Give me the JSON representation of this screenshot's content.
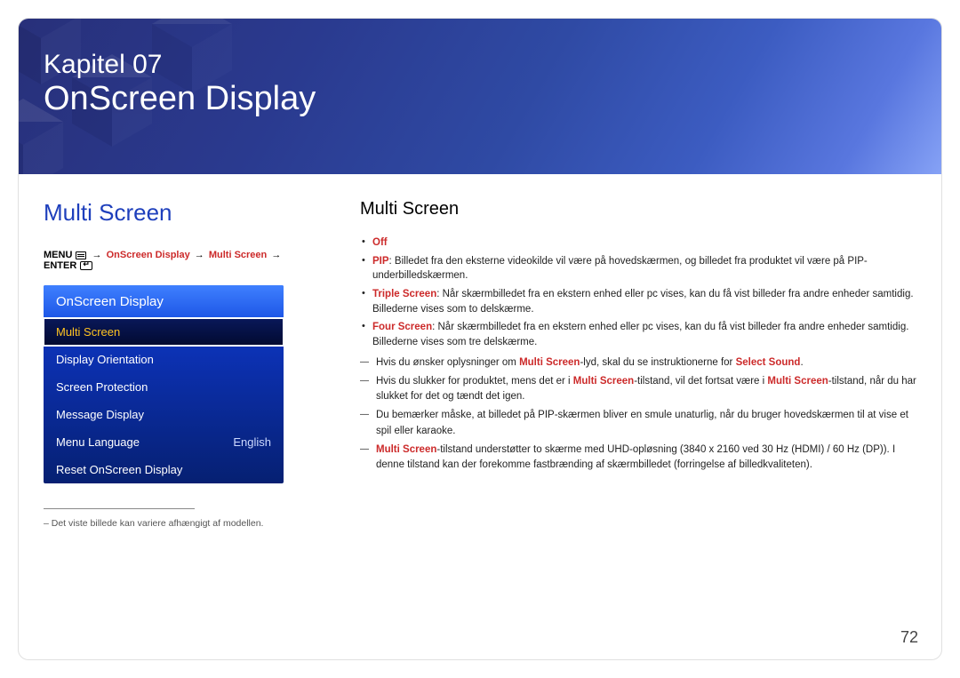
{
  "banner": {
    "chapter": "Kapitel 07",
    "name": "OnScreen Display"
  },
  "left": {
    "section_title": "Multi Screen",
    "breadcrumb": {
      "menu": "MENU",
      "p1": "OnScreen Display",
      "p2": "Multi Screen",
      "enter": "ENTER"
    },
    "osd": {
      "header": "OnScreen Display",
      "items": [
        {
          "label": "Multi Screen",
          "value": "",
          "selected": true
        },
        {
          "label": "Display Orientation",
          "value": "",
          "selected": false
        },
        {
          "label": "Screen Protection",
          "value": "",
          "selected": false
        },
        {
          "label": "Message Display",
          "value": "",
          "selected": false
        },
        {
          "label": "Menu Language",
          "value": "English",
          "selected": false
        },
        {
          "label": "Reset OnScreen Display",
          "value": "",
          "selected": false
        }
      ]
    },
    "footnote": "– Det viste billede kan variere afhængigt af modellen."
  },
  "right": {
    "title": "Multi Screen",
    "bullets": {
      "b0": "Off",
      "b1_lead": "PIP",
      "b1_rest": ": Billedet fra den eksterne videokilde vil være på hovedskærmen, og billedet fra produktet vil være på PIP-underbilledskærmen.",
      "b2_lead": "Triple Screen",
      "b2_rest": ": Når skærmbilledet fra en ekstern enhed eller pc vises, kan du få vist billeder fra andre enheder samtidig. Billederne vises som to delskærme.",
      "b3_lead": "Four Screen",
      "b3_rest": ": Når skærmbilledet fra en ekstern enhed eller pc vises, kan du få vist billeder fra andre enheder samtidig. Billederne vises som tre delskærme."
    },
    "dashes": {
      "d0_a": "Hvis du ønsker oplysninger om ",
      "d0_b": "Multi Screen",
      "d0_c": "-lyd, skal du se instruktionerne for ",
      "d0_d": "Select Sound",
      "d0_e": ".",
      "d1_a": "Hvis du slukker for produktet, mens det er i ",
      "d1_b": "Multi Screen",
      "d1_c": "-tilstand, vil det fortsat være i ",
      "d1_d": "Multi Screen",
      "d1_e": "-tilstand, når du har slukket for det og tændt det igen.",
      "d2": "Du bemærker måske, at billedet på PIP-skærmen bliver en smule unaturlig, når du bruger hovedskærmen til at vise et spil eller karaoke.",
      "d3_a": "Multi Screen",
      "d3_b": "-tilstand understøtter to skærme med UHD-opløsning (3840 x 2160 ved 30 Hz (HDMI) / 60 Hz (DP)). I denne tilstand kan der forekomme fastbrænding af skærmbilledet (forringelse af billedkvaliteten)."
    }
  },
  "page_number": "72"
}
